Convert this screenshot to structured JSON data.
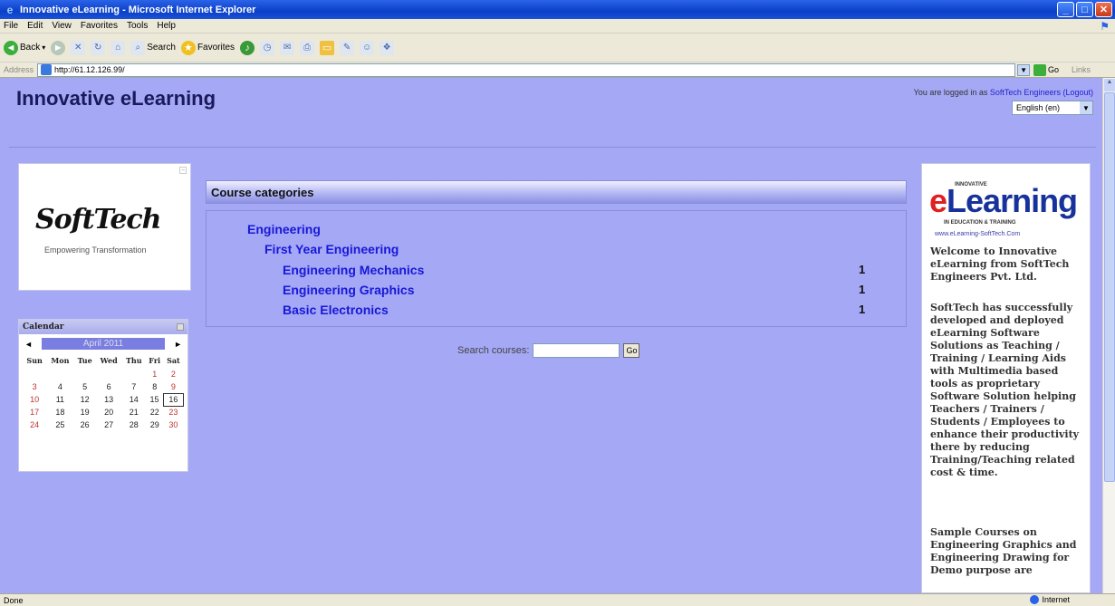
{
  "window": {
    "title": "Innovative eLearning - Microsoft Internet Explorer",
    "minimize": "_",
    "maximize": "□",
    "close": "✕"
  },
  "menu": [
    "File",
    "Edit",
    "View",
    "Favorites",
    "Tools",
    "Help"
  ],
  "toolbar": {
    "back": "Back",
    "search": "Search",
    "favorites": "Favorites"
  },
  "address": {
    "label": "Address",
    "url": "http://61.12.126.99/",
    "go": "Go",
    "links": "Links"
  },
  "status": {
    "left": "Done",
    "zone": "Internet"
  },
  "header": {
    "site_name": "Innovative eLearning",
    "login_prefix": "You are logged in as",
    "login_user": "SoftTech Engineers",
    "logout": "(Logout)",
    "language": "English (en)"
  },
  "logo": {
    "brand": "SoftTech",
    "tagline": "Empowering Transformation"
  },
  "calendar": {
    "title": "Calendar",
    "month": "April 2011",
    "prev": "◄",
    "next": "►",
    "days": [
      "Sun",
      "Mon",
      "Tue",
      "Wed",
      "Thu",
      "Fri",
      "Sat"
    ],
    "weeks": [
      [
        "",
        "",
        "",
        "",
        "",
        "1",
        "2"
      ],
      [
        "3",
        "4",
        "5",
        "6",
        "7",
        "8",
        "9"
      ],
      [
        "10",
        "11",
        "12",
        "13",
        "14",
        "15",
        "16"
      ],
      [
        "17",
        "18",
        "19",
        "20",
        "21",
        "22",
        "23"
      ],
      [
        "24",
        "25",
        "26",
        "27",
        "28",
        "29",
        "30"
      ]
    ],
    "today": "16"
  },
  "categories": {
    "heading": "Course categories",
    "top": "Engineering",
    "sub": "First Year Engineering",
    "courses": [
      {
        "name": "Engineering Mechanics",
        "count": "1"
      },
      {
        "name": "Engineering Graphics",
        "count": "1"
      },
      {
        "name": "Basic Electronics",
        "count": "1"
      }
    ]
  },
  "search": {
    "label": "Search courses:",
    "button": "Go"
  },
  "promo": {
    "innovative": "INNOVATIVE",
    "e": "e",
    "learning": "Learning",
    "subtitle": "IN EDUCATION & TRAINING",
    "url": "www.eLearning-SoftTech.Com",
    "p1": "Welcome to Innovative eLearning from SoftTech Engineers Pvt. Ltd.",
    "p2": "SoftTech has successfully developed and deployed eLearning Software Solutions as Teaching / Training / Learning Aids with Multimedia based tools as proprietary Software Solution helping Teachers / Trainers / Students / Employees to enhance their productivity there by reducing Training/Teaching related cost & time.",
    "p3": "Sample Courses on Engineering Graphics and Engineering Drawing for Demo purpose are"
  },
  "colors": {
    "page_bg": "#a4a8f5",
    "link": "#1818d8",
    "titlebar": "#0a40c8"
  }
}
